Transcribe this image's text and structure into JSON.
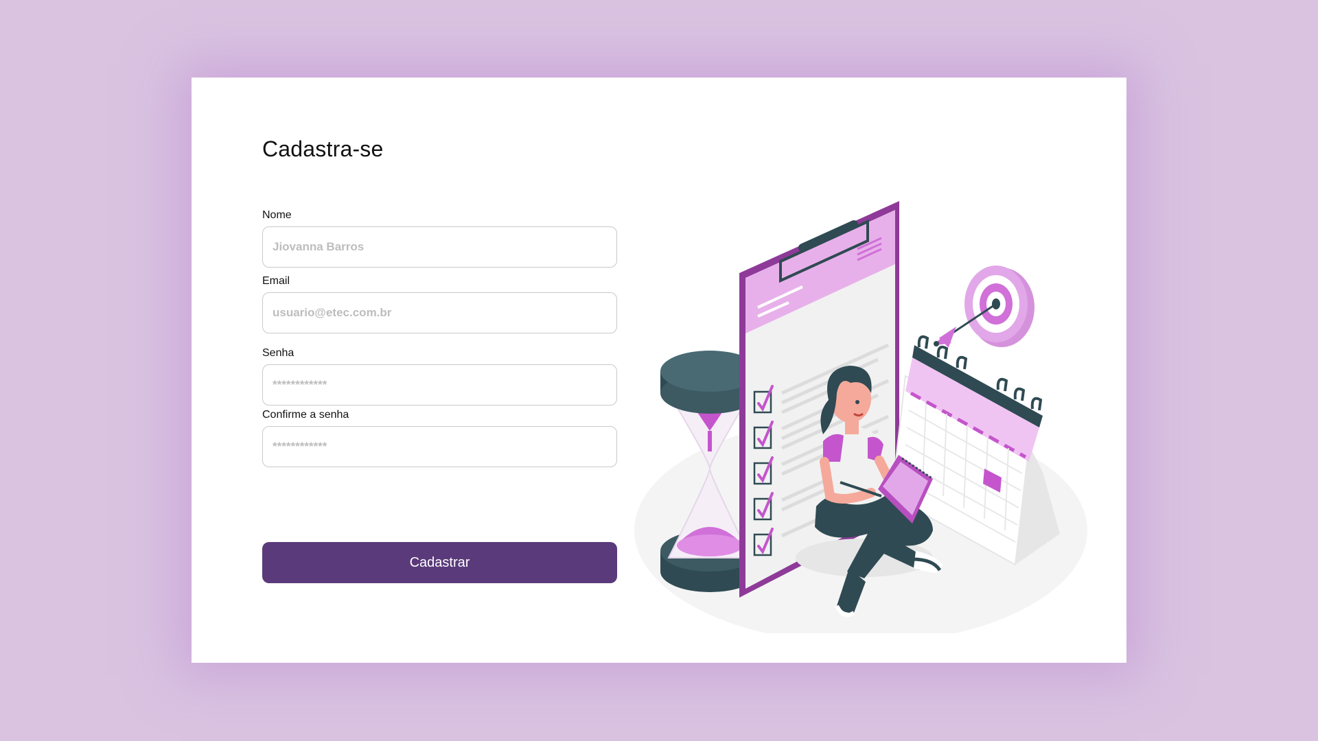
{
  "form": {
    "title": "Cadastra-se",
    "fields": [
      {
        "label": "Nome",
        "placeholder": "Jiovanna Barros"
      },
      {
        "label": "Email",
        "placeholder": "usuario@etec.com.br"
      },
      {
        "label": "Senha",
        "placeholder": "************"
      },
      {
        "label": "Confirme a senha",
        "placeholder": "************"
      }
    ],
    "submit_label": "Cadastrar"
  },
  "colors": {
    "background": "#d9c3e1",
    "button": "#5a3a7b",
    "accent_purple": "#9b3fa0",
    "accent_pink": "#d070d8",
    "dark_teal": "#2f4a52"
  },
  "illustration": {
    "icons": [
      "clipboard-checklist-icon",
      "hourglass-icon",
      "calendar-icon",
      "target-arrow-icon",
      "person-writing-icon"
    ]
  }
}
